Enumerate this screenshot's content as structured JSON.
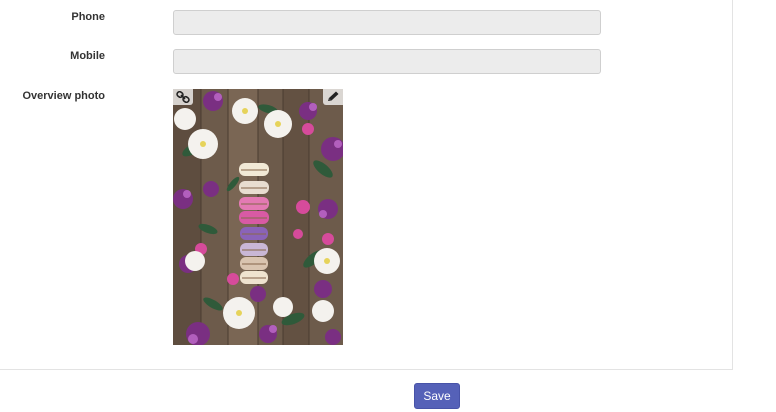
{
  "form": {
    "phone": {
      "label": "Phone",
      "value": "",
      "placeholder": ""
    },
    "mobile": {
      "label": "Mobile",
      "value": "",
      "placeholder": ""
    },
    "overview_photo": {
      "label": "Overview photo",
      "link_icon": "link-icon",
      "edit_icon": "pencil-icon"
    }
  },
  "footer": {
    "save_label": "Save"
  },
  "colors": {
    "save_button": "#5561b8",
    "field_background": "#ececec"
  }
}
